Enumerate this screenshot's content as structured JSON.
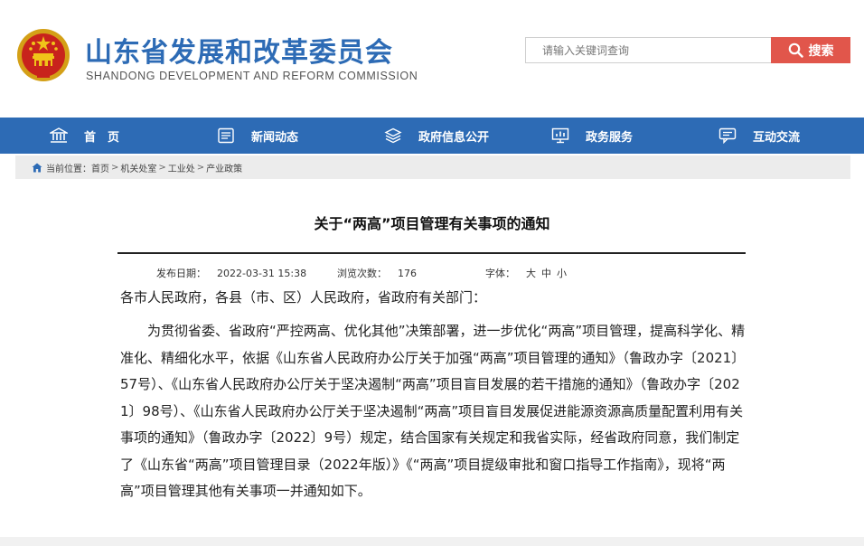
{
  "site": {
    "title": "山东省发展和改革委员会",
    "subtitle": "SHANDONG DEVELOPMENT AND REFORM COMMISSION"
  },
  "search": {
    "placeholder": "请输入关键词查询",
    "button_label": "搜索"
  },
  "nav": {
    "items": [
      {
        "label": "首　页",
        "icon": "building-icon"
      },
      {
        "label": "新闻动态",
        "icon": "news-icon"
      },
      {
        "label": "政府信息公开",
        "icon": "layers-icon"
      },
      {
        "label": "政务服务",
        "icon": "chart-screen-icon"
      },
      {
        "label": "互动交流",
        "icon": "chat-icon"
      }
    ]
  },
  "breadcrumb": {
    "prefix": "当前位置：",
    "items": [
      "首页",
      "机关处室",
      "工业处",
      "产业政策"
    ],
    "separator": ">"
  },
  "article": {
    "title": "关于“两高”项目管理有关事项的通知",
    "publish_label": "发布日期：",
    "publish_date": "2022-03-31 15:38",
    "views_label": "浏览次数：",
    "views": "176",
    "font_label": "字体：",
    "font_sizes": [
      "大",
      "中",
      "小"
    ],
    "salutation": "各市人民政府，各县（市、区）人民政府，省政府有关部门：",
    "paragraph": "为贯彻省委、省政府“严控两高、优化其他”决策部署，进一步优化“两高”项目管理，提高科学化、精准化、精细化水平，依据《山东省人民政府办公厅关于加强“两高”项目管理的通知》（鲁政办字〔2021〕57号）、《山东省人民政府办公厅关于坚决遏制“两高”项目盲目发展的若干措施的通知》（鲁政办字〔2021〕98号）、《山东省人民政府办公厅关于坚决遏制“两高”项目盲目发展促进能源资源高质量配置利用有关事项的通知》（鲁政办字〔2022〕9号）规定，结合国家有关规定和我省实际，经省政府同意，我们制定了《山东省“两高”项目管理目录（2022年版）》《“两高”项目提级审批和窗口指导工作指南》，现将“两高”项目管理其他有关事项一并通知如下。"
  },
  "colors": {
    "brand_blue": "#2d6bb5",
    "search_red": "#e1564b",
    "breadcrumb_bg": "#ececec"
  }
}
